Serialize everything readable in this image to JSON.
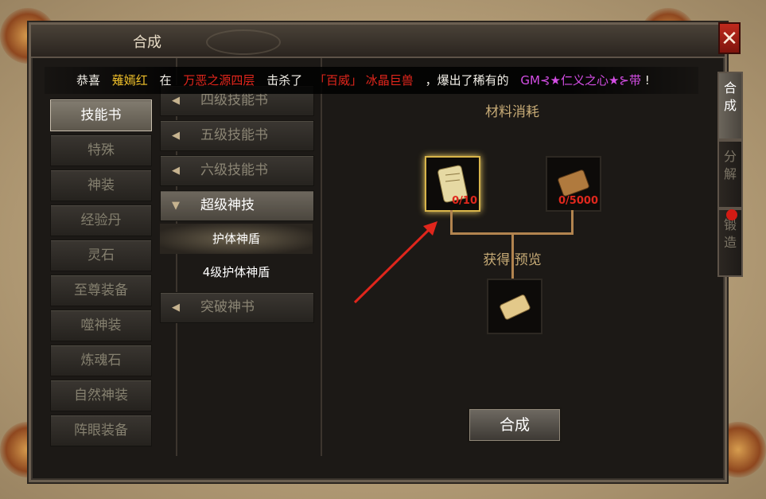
{
  "window": {
    "title": "合成",
    "close_icon": "close-icon"
  },
  "broadcast": {
    "prefix": "恭喜",
    "player": "薙嫣红",
    "at": "在",
    "location": "万恶之源四层",
    "killed": "击杀了",
    "monster_tag": "「百威」",
    "monster": "冰晶巨兽",
    "dropped": "，爆出了稀有的",
    "item": "GM⊰★仁义之心★⊱带",
    "end": "!"
  },
  "left_menu": [
    {
      "label": "技能书",
      "active": true
    },
    {
      "label": "特殊"
    },
    {
      "label": "神装"
    },
    {
      "label": "经验丹"
    },
    {
      "label": "灵石"
    },
    {
      "label": "至尊装备"
    },
    {
      "label": "噬神装"
    },
    {
      "label": "炼魂石"
    },
    {
      "label": "自然神装"
    },
    {
      "label": "阵眼装备"
    }
  ],
  "mid_menu": {
    "items": [
      {
        "label": "四级技能书"
      },
      {
        "label": "五级技能书"
      },
      {
        "label": "六级技能书"
      },
      {
        "label": "超级神技",
        "open": true
      }
    ],
    "subitems": [
      {
        "label": "护体神盾",
        "selected": true
      },
      {
        "label": "4级护体神盾"
      }
    ],
    "after": [
      {
        "label": "突破神书"
      }
    ]
  },
  "materials": {
    "header": "材料消耗",
    "slot1_count": "0/10",
    "slot2_count": "0/5000"
  },
  "preview": {
    "header": "获得 预览"
  },
  "compose_button": "合成",
  "side_tabs": [
    {
      "label": "合成",
      "active": true
    },
    {
      "label": "分解"
    },
    {
      "label": "锻造"
    }
  ]
}
